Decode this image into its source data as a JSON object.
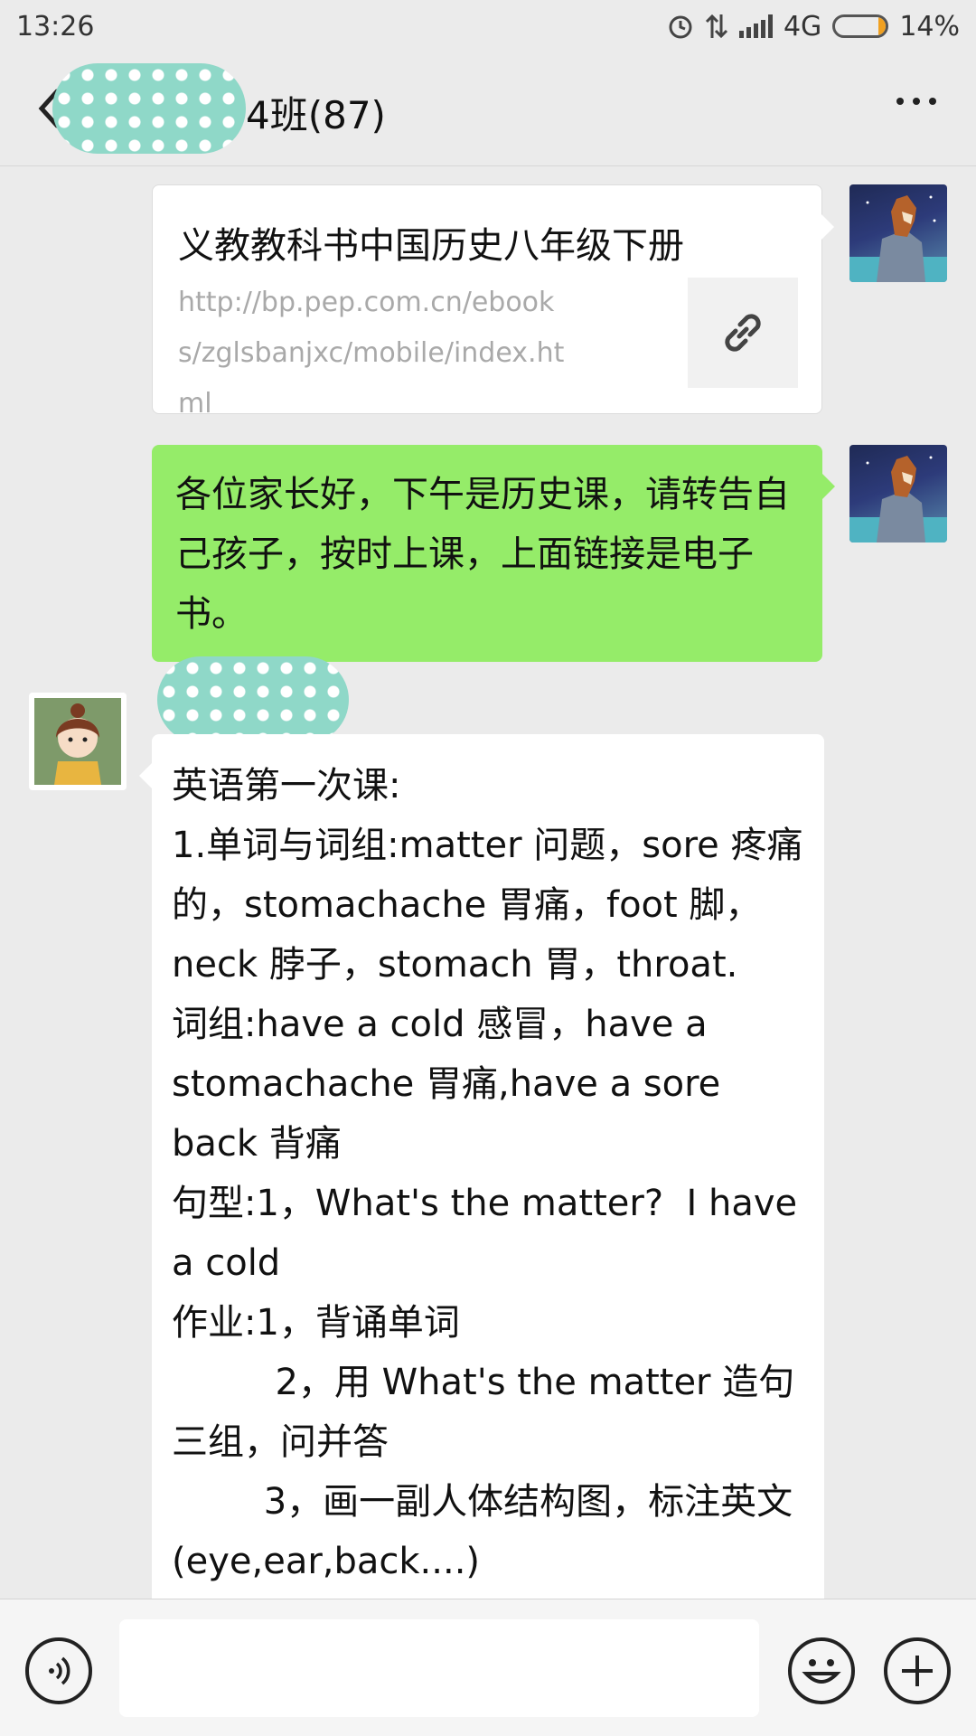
{
  "status_bar": {
    "time": "13:26",
    "network": "4G",
    "battery": "14%",
    "battery_level": 0.14
  },
  "header": {
    "title": "4班(87)",
    "back_icon": "chevron-left-icon",
    "more_icon": "more-dots-icon"
  },
  "messages": [
    {
      "type": "link",
      "sender": "self",
      "title": "义教教科书中国历史八年级下册",
      "url": "http://bp.pep.com.cn/ebooks/zglsbanjxc/mobile/index.html",
      "thumb_icon": "link-icon"
    },
    {
      "type": "text",
      "sender": "self",
      "text": "各位家长好，下午是历史课，请转告自己孩子，按时上课，上面链接是电子书。"
    },
    {
      "type": "text",
      "sender": "other",
      "text": "英语第一次课:\n1.单词与词组:matter 问题，sore 疼痛的，stomachache 胃痛，foot 脚，neck 脖子，stomach 胃，throat.\n词组:have a cold 感冒，have a stomachache 胃痛,have a sore back 背痛\n句型:1，What's the matter?  I have a cold\n作业:1，背诵单词\n         2，用 What's the matter 造句三组，问并答\n        3，画一副人体结构图，标注英文(eye,ear,back....)"
    }
  ],
  "input_bar": {
    "voice_icon": "voice-icon",
    "emoji_icon": "emoji-icon",
    "plus_icon": "plus-icon",
    "placeholder": ""
  },
  "colors": {
    "background": "#ebebeb",
    "self_bubble": "#95ec69",
    "other_bubble": "#ffffff"
  }
}
